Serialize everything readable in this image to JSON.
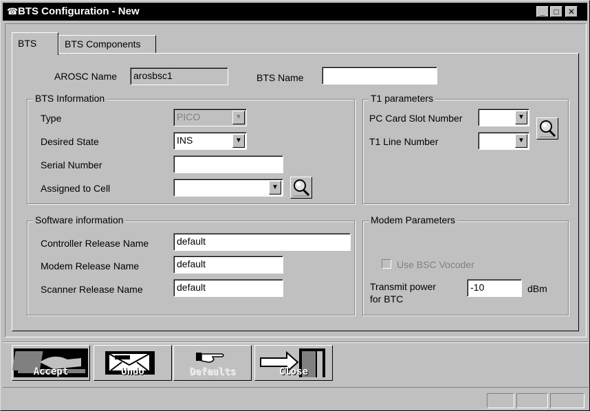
{
  "window": {
    "title": "BTS Configuration - New",
    "minimize_label": "_",
    "maximize_label": "□",
    "close_label": "✕"
  },
  "tabs": [
    {
      "label": "BTS"
    },
    {
      "label": "BTS Components"
    }
  ],
  "header": {
    "arosc_label": "AROSC Name",
    "arosc_value": "arosbsc1",
    "bts_name_label": "BTS Name",
    "bts_name_value": ""
  },
  "bts_info": {
    "title": "BTS Information",
    "type_label": "Type",
    "type_value": "PICO",
    "desired_state_label": "Desired State",
    "desired_state_value": "INS",
    "serial_label": "Serial Number",
    "serial_value": "",
    "assigned_cell_label": "Assigned to Cell",
    "assigned_cell_value": ""
  },
  "t1": {
    "title": "T1 parameters",
    "pc_card_label": "PC Card Slot Number",
    "pc_card_value": "",
    "t1_line_label": "T1 Line Number",
    "t1_line_value": ""
  },
  "software": {
    "title": "Software information",
    "controller_label": "Controller Release Name",
    "controller_value": "default",
    "modem_label": "Modem Release Name",
    "modem_value": "default",
    "scanner_label": "Scanner Release Name",
    "scanner_value": "default"
  },
  "modem": {
    "title": "Modem Parameters",
    "vocoder_label": "Use BSC Vocoder",
    "vocoder_checked": false,
    "tx_power_label_line1": "Transmit power",
    "tx_power_label_line2": "for BTC",
    "tx_power_value": "-10",
    "tx_power_unit": "dBm"
  },
  "toolbar": {
    "accept_label": "Accept",
    "undo_label": "Undo",
    "defaults_label": "Defaults",
    "close_label": "Close"
  },
  "icons": {
    "title": "phone-icon",
    "search": "magnifier-icon"
  }
}
